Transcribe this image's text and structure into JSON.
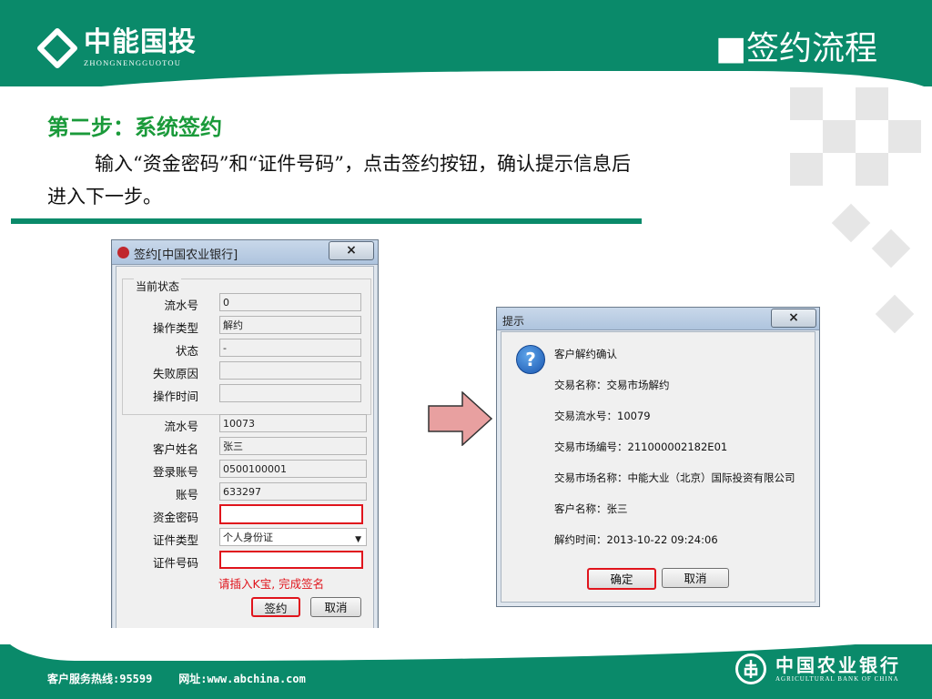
{
  "header": {
    "brand_cn": "中能国投",
    "brand_en": "ZHONGNENGGUOTOU",
    "section_title": "■签约流程"
  },
  "content": {
    "step_title": "第二步：系统签约",
    "step_desc_line1": "输入“资金密码”和“证件号码”，点击签约按钮，确认提示信息后",
    "step_desc_line2": "进入下一步。"
  },
  "sign_dialog": {
    "title": "签约[中国农业银行]",
    "close_label": "×",
    "status_group": {
      "legend": "当前状态",
      "rows": [
        {
          "label": "流水号",
          "value": "0"
        },
        {
          "label": "操作类型",
          "value": "解约"
        },
        {
          "label": "状态",
          "value": "-"
        },
        {
          "label": "失败原因",
          "value": ""
        },
        {
          "label": "操作时间",
          "value": ""
        }
      ]
    },
    "form_rows": [
      {
        "label": "流水号",
        "value": "10073"
      },
      {
        "label": "客户姓名",
        "value": "张三"
      },
      {
        "label": "登录账号",
        "value": "0500100001"
      },
      {
        "label": "账号",
        "value": "633297"
      },
      {
        "label": "资金密码",
        "value": ""
      },
      {
        "label": "证件类型",
        "value": "个人身份证"
      },
      {
        "label": "证件号码",
        "value": ""
      }
    ],
    "hint": "请插入K宝, 完成签名",
    "sign_button": "签约",
    "cancel_button": "取消"
  },
  "confirm_dialog": {
    "title": "提示",
    "close_label": "×",
    "lines": [
      "客户解约确认",
      "交易名称：交易市场解约",
      "交易流水号：10079",
      "交易市场编号：211000002182E01",
      "交易市场名称：中能大业（北京）国际投资有限公司",
      "客户名称：张三",
      "解约时间：2013-10-22 09:24:06"
    ],
    "ok_button": "确定",
    "cancel_button": "取消"
  },
  "footer": {
    "hotline": "客户服务热线:95599",
    "website": "网址:www.abchina.com",
    "bank_cn": "中国农业银行",
    "bank_en": "AGRICULTURAL BANK OF CHINA"
  },
  "colors": {
    "brand_green": "#0a8a6a",
    "step_title_green": "#1a9a3a",
    "highlight_red": "#e0141c",
    "arrow_fill": "#e8a0a0"
  },
  "icons": [
    "brand-logo-icon",
    "abc-bank-icon",
    "close-icon",
    "dropdown-arrow-icon",
    "question-icon",
    "right-arrow-icon",
    "abc-bank-logo-icon"
  ]
}
